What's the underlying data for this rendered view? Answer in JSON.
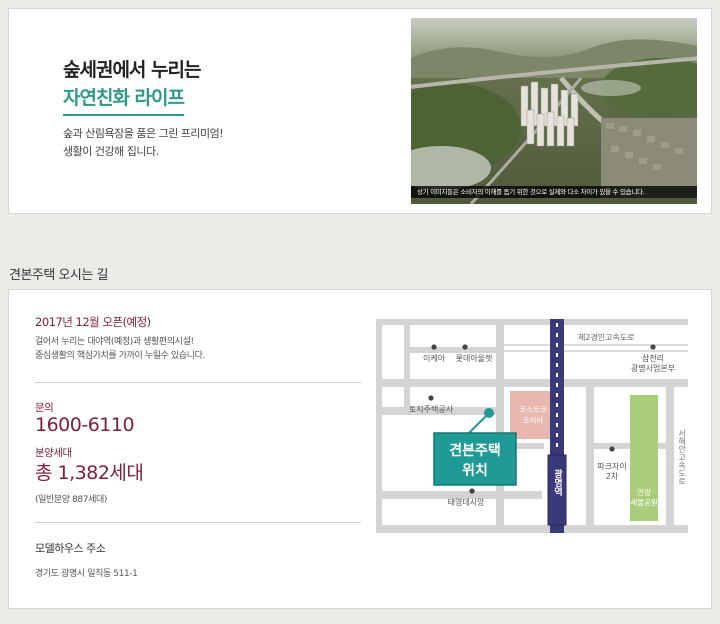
{
  "feature": {
    "headline": "숲세권에서 누리는",
    "subhead": "자연친화 라이프",
    "desc_line1": "숲과 산림욕장을 품은 그린 프리미엄!",
    "desc_line2": "생활이 건강해 집니다.",
    "photo_caption": "상기 이미지들은 소비자의 이해를 돕기 위한 것으로 실제와 다소 차이가 있을 수 있습니다."
  },
  "directions": {
    "section_title": "견본주택 오시는 길",
    "open_date": "2017년 12월 오픈(예정)",
    "open_desc_line1": "걸어서 누리는 대야역(예정)과 생활편의시설!",
    "open_desc_line2": "중심생활의 핵심가치를 가까이 누릴수 있습니다.",
    "inquiry_label": "문의",
    "inquiry_phone": "1600-6110",
    "units_label": "분양세대",
    "units_value": "총 1,382세대",
    "units_note": "(일반분양 887세대)",
    "model_house_label": "모델하우스 주소",
    "model_house_address": "경기도 광명시 일직동 511-1"
  },
  "map": {
    "road_top": "제2경인고속도로",
    "road_right": "서해안고속도로",
    "ikea": "이케아",
    "lotte": "롯데아울렛",
    "samchully_line1": "삼천리",
    "samchully_line2": "광명사업본부",
    "lh": "토지주택공사",
    "costco_line1": "코스트코",
    "costco_line2": "코리아",
    "model_house_line1": "견본주택",
    "model_house_line2": "위치",
    "station": "광명역",
    "prugio_line1": "파크자이",
    "prugio_line2": "2차",
    "park_line1": "안양",
    "park_line2": "새물공원",
    "taeyoung": "태영데시앙"
  },
  "colors": {
    "accent_green": "#2d9a87",
    "accent_maroon": "#7d1e3a",
    "station_navy": "#3a3a7a",
    "badge_teal": "#1f9a95",
    "park_green": "#a9cd7a",
    "costco_pink": "#e8b7ad"
  }
}
